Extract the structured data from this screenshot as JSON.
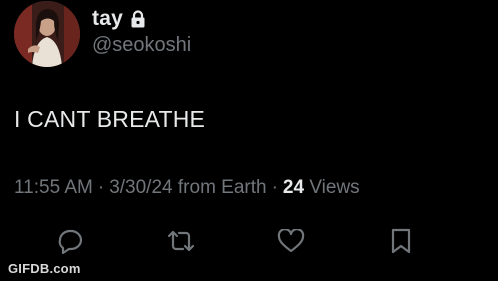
{
  "author": {
    "display_name": "tay",
    "handle": "@seokoshi",
    "protected_icon": "lock-icon"
  },
  "tweet": {
    "text": "I CANT BREATHE"
  },
  "meta": {
    "time": "11:55 AM",
    "separator": "·",
    "date": "3/30/24",
    "source": "from Earth",
    "views_count": "24",
    "views_label": "Views"
  },
  "actions": [
    {
      "icon": "reply-icon"
    },
    {
      "icon": "repost-icon"
    },
    {
      "icon": "like-icon"
    },
    {
      "icon": "bookmark-icon"
    }
  ],
  "watermark": "GIFDB.com",
  "colors": {
    "background": "#000000",
    "primary_text": "#e7e9ea",
    "secondary_text": "#71767b"
  }
}
